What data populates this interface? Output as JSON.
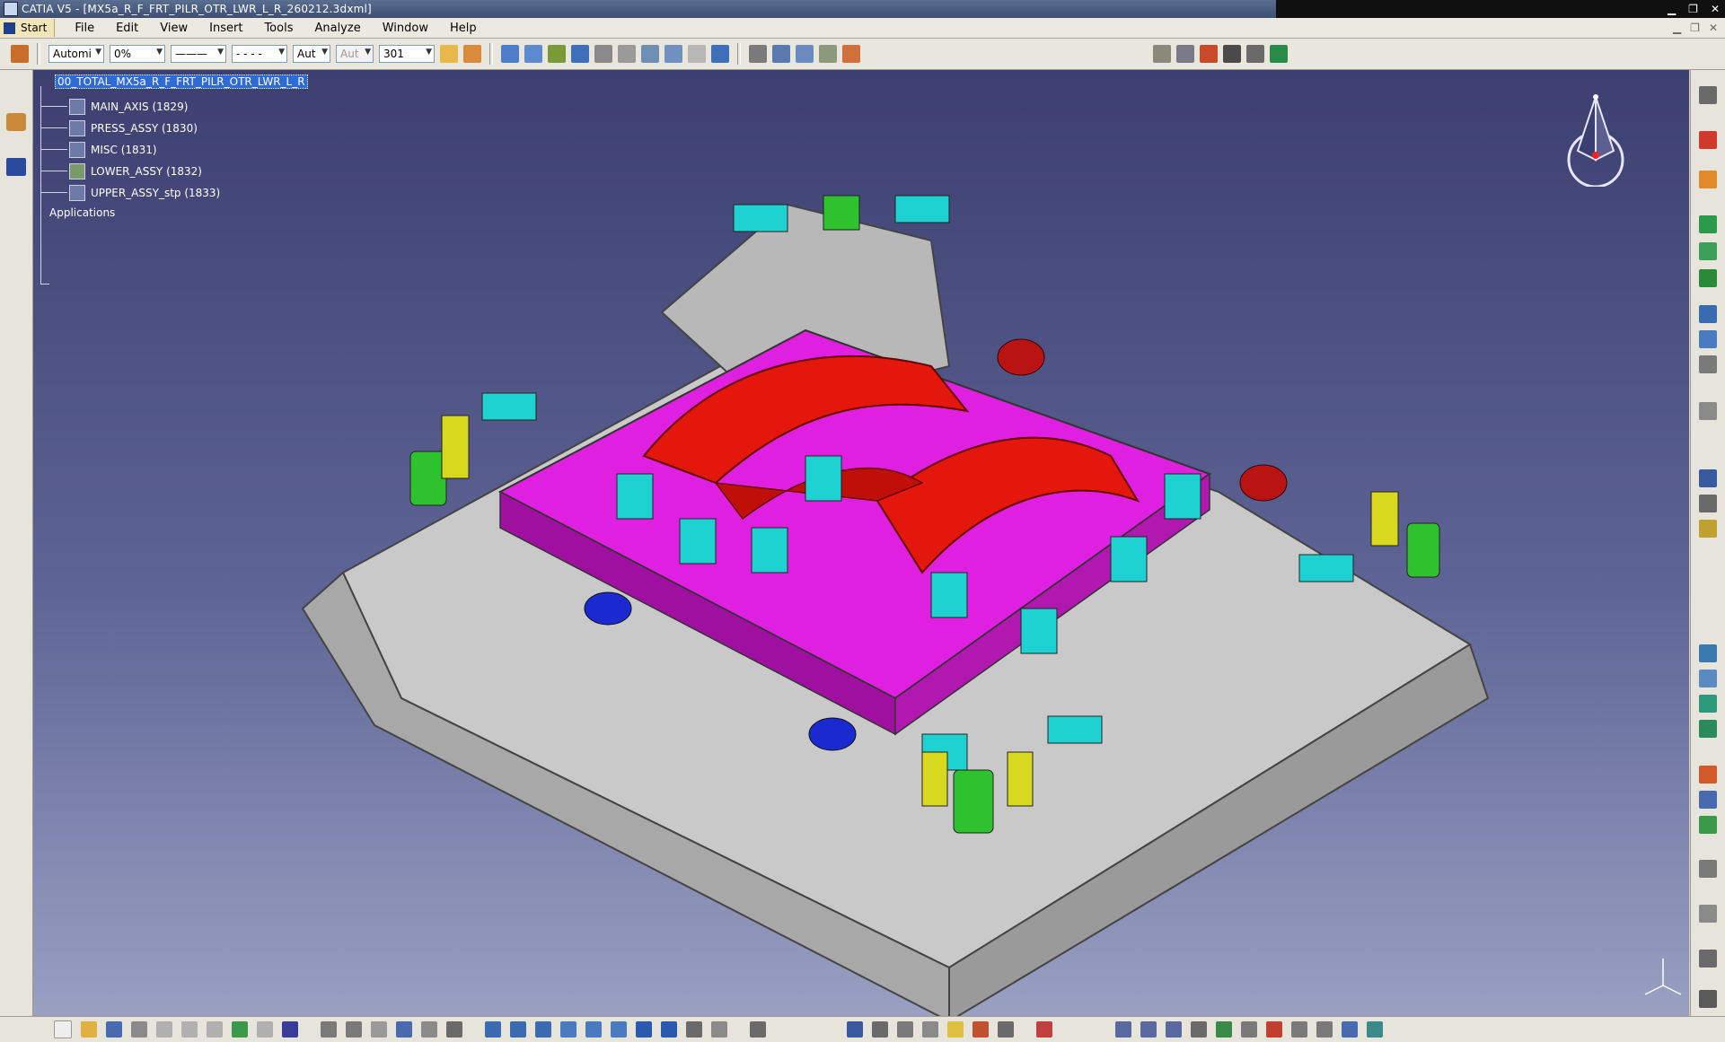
{
  "window": {
    "title": "CATIA V5 - [MX5a_R_F_FRT_PILR_OTR_LWR_L_R_260212.3dxml]"
  },
  "menu": {
    "start_label": "Start",
    "items": [
      "File",
      "Edit",
      "View",
      "Insert",
      "Tools",
      "Analyze",
      "Window",
      "Help"
    ]
  },
  "toolbar": {
    "color_combo": "Automi",
    "transparency_combo": "0%",
    "line_thickness_combo": "———",
    "line_type_combo": "- - - -",
    "layer_combo": "Aut",
    "layer_combo_disabled": "Aut",
    "zoom_combo": "301"
  },
  "tree": {
    "root": "00_TOTAL_MX5a_R_F_FRT_PILR_OTR_LWR_L_R",
    "children": [
      "MAIN_AXIS (1829)",
      "PRESS_ASSY (1830)",
      "MISC (1831)",
      "LOWER_ASSY (1832)",
      "UPPER_ASSY_stp (1833)"
    ],
    "applications": "Applications"
  },
  "icons": {
    "compass": "compass-icon",
    "axis": "axis-triad-icon"
  }
}
